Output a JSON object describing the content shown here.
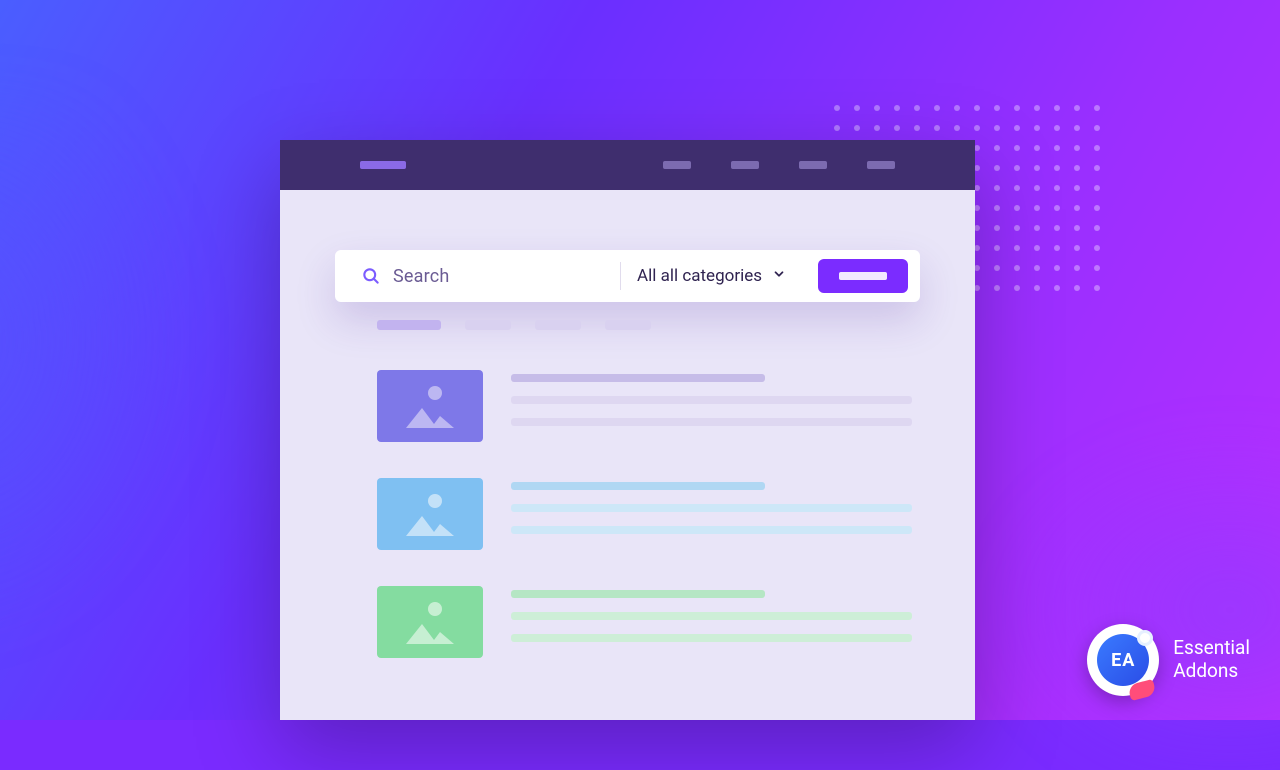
{
  "search": {
    "placeholder": "Search",
    "category_label": "All all categories"
  },
  "badge": {
    "line1": "Essential",
    "line2": "Addons",
    "mark": "EA"
  },
  "colors": {
    "accent": "#7b2cff",
    "result1": "#7e78e8",
    "result2": "#7fc0f2",
    "result3": "#84dca0"
  }
}
